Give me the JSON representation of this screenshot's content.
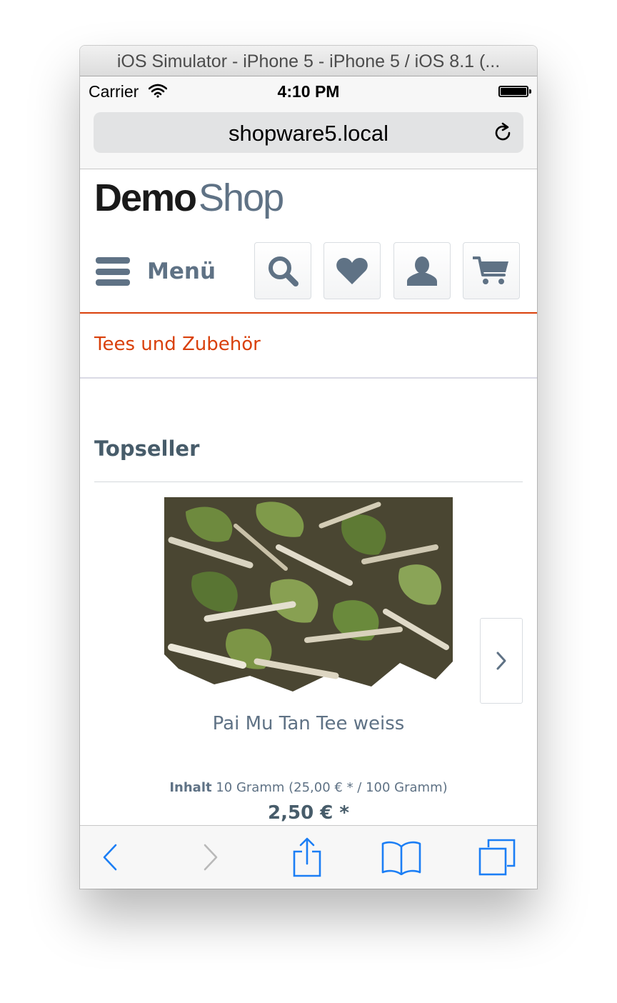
{
  "simulator": {
    "title": "iOS Simulator - iPhone 5 - iPhone 5 / iOS 8.1 (..."
  },
  "statusbar": {
    "carrier": "Carrier",
    "time": "4:10 PM"
  },
  "browser": {
    "url": "shopware5.local"
  },
  "shop": {
    "logo_demo": "Demo",
    "logo_shop": "Shop",
    "menu_label": "Menü",
    "breadcrumb": "Tees und Zubehör",
    "section_title": "Topseller"
  },
  "product": {
    "name": "Pai Mu Tan Tee weiss",
    "content_label": "Inhalt",
    "content_value": "10 Gramm (25,00 € * / 100 Gramm)",
    "price": "2,50 € *"
  },
  "colors": {
    "accent": "#d9400b",
    "text_blue_grey": "#5f7285",
    "ios_blue": "#1b7ef5"
  },
  "icons": {
    "header": [
      "search-icon",
      "heart-icon",
      "user-icon",
      "cart-icon"
    ],
    "toolbar": [
      "back-icon",
      "forward-icon",
      "share-icon",
      "bookmarks-icon",
      "tabs-icon"
    ]
  }
}
